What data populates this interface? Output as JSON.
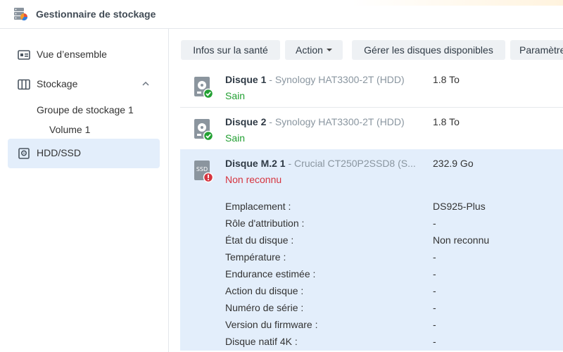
{
  "app": {
    "title": "Gestionnaire de stockage",
    "icon": "storage-manager-icon"
  },
  "sidebar": {
    "items": [
      {
        "label": "Vue d’ensemble",
        "icon": "overview-icon"
      },
      {
        "label": "Stockage",
        "icon": "storage-icon",
        "expanded": true
      },
      {
        "label": "HDD/SSD",
        "icon": "hdd-icon",
        "active": true
      }
    ],
    "subitems": [
      {
        "label": "Groupe de stockage 1"
      },
      {
        "label": "Volume 1"
      }
    ]
  },
  "toolbar": {
    "health_info": "Infos sur la santé",
    "action": "Action",
    "manage_disks": "Gérer les disques disponibles",
    "settings": "Paramètre"
  },
  "disks": [
    {
      "name": "Disque 1",
      "separator": " - ",
      "model": "Synology HAT3300-2T (HDD)",
      "size": "1.8 To",
      "status": "Sain",
      "status_kind": "ok",
      "type": "HDD"
    },
    {
      "name": "Disque 2",
      "separator": " - ",
      "model": "Synology HAT3300-2T (HDD)",
      "size": "1.8 To",
      "status": "Sain",
      "status_kind": "ok",
      "type": "HDD"
    },
    {
      "name": "Disque M.2 1",
      "separator": " - ",
      "model": "Crucial CT250P2SSD8 (S...",
      "size": "232.9 Go",
      "status": "Non reconnu",
      "status_kind": "error",
      "type": "SSD",
      "icon_label": "SSD"
    }
  ],
  "details": [
    {
      "label": "Emplacement :",
      "value": "DS925-Plus"
    },
    {
      "label": "Rôle d'attribution :",
      "value": "-"
    },
    {
      "label": "État du disque :",
      "value": "Non reconnu",
      "value_kind": "error"
    },
    {
      "label": "Température :",
      "value": "-"
    },
    {
      "label": "Endurance estimée :",
      "value": "-"
    },
    {
      "label": "Action du disque :",
      "value": "-"
    },
    {
      "label": "Numéro de série :",
      "value": "-"
    },
    {
      "label": "Version du firmware :",
      "value": "-"
    },
    {
      "label": "Disque natif 4K :",
      "value": "-"
    }
  ],
  "colors": {
    "accent_selected": "#e3eefb",
    "ok": "#23a033",
    "error": "#d6343f"
  }
}
